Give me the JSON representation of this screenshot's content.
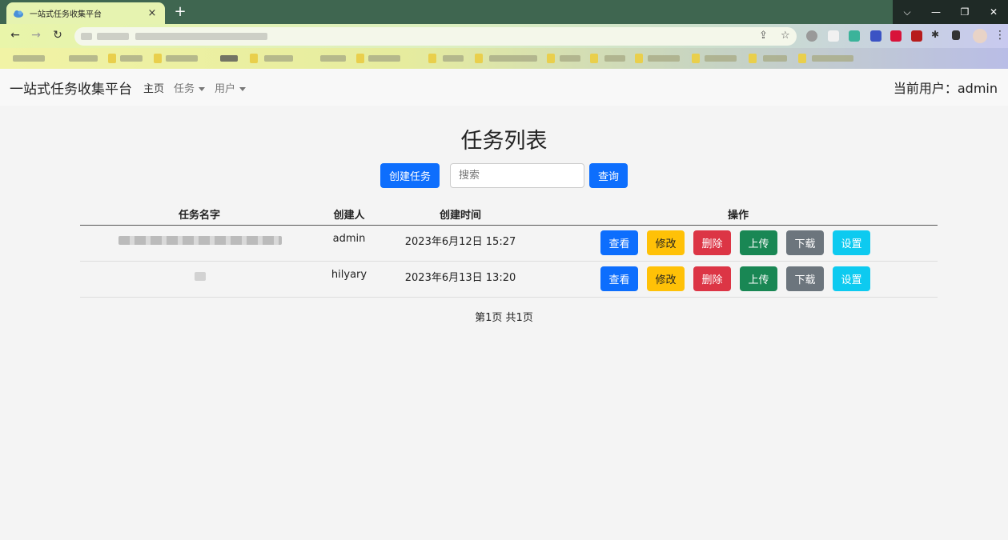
{
  "browser": {
    "tab_title": "一站式任务收集平台",
    "tab_close": "×",
    "new_tab": "+",
    "controls": {
      "dropdown": "⌵",
      "minimize": "—",
      "restore": "❐",
      "close": "✕"
    }
  },
  "navbar": {
    "brand": "一站式任务收集平台",
    "links": [
      {
        "label": "主页"
      },
      {
        "label": "任务"
      },
      {
        "label": "用户"
      }
    ],
    "current_user": "当前用户：admin"
  },
  "page": {
    "title": "任务列表",
    "create_button": "创建任务",
    "search_placeholder": "搜索",
    "query_button": "查询"
  },
  "table": {
    "headers": [
      "任务名字",
      "创建人",
      "创建时间",
      "操作"
    ],
    "rows": [
      {
        "name": "",
        "creator": "admin",
        "created": "2023年6月12日 15:27"
      },
      {
        "name": "",
        "creator": "hilyary",
        "created": "2023年6月13日 13:20"
      }
    ],
    "actions": [
      "查看",
      "修改",
      "删除",
      "上传",
      "下载",
      "设置"
    ]
  },
  "pagination": "第1页 共1页",
  "colors": {
    "primary": "#0d6efd",
    "warning": "#ffc107",
    "danger": "#dc3545",
    "success": "#198754",
    "secondary": "#6c757d",
    "info": "#0dcaf0"
  }
}
